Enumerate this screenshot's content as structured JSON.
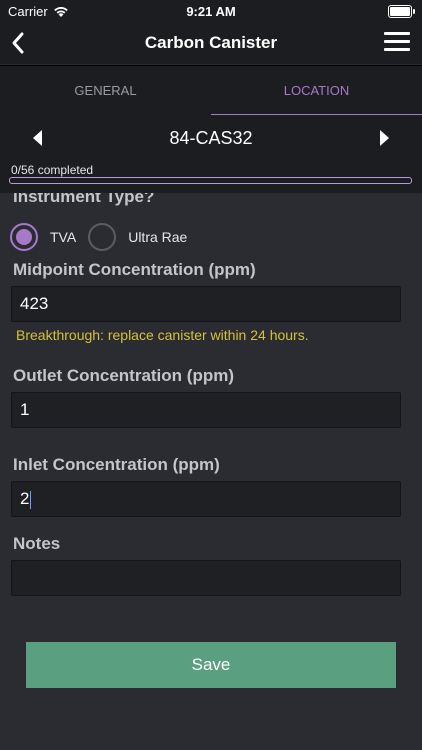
{
  "status_bar": {
    "carrier": "Carrier",
    "time": "9:21 AM",
    "battery_level": 1.0
  },
  "header": {
    "title": "Carbon Canister"
  },
  "tabs": [
    {
      "label": "GENERAL",
      "active": false
    },
    {
      "label": "LOCATION",
      "active": true
    }
  ],
  "selector": {
    "current": "84-CAS32"
  },
  "progress": {
    "text": "0/56 completed",
    "fraction": 0.0
  },
  "form": {
    "instrument_type": {
      "label": "Instrument Type?",
      "options": [
        {
          "label": "TVA",
          "selected": true
        },
        {
          "label": "Ultra Rae",
          "selected": false
        }
      ]
    },
    "midpoint": {
      "label": "Midpoint Concentration (ppm)",
      "value": "423"
    },
    "warning": "Breakthrough: replace canister within 24 hours.",
    "outlet": {
      "label": "Outlet Concentration (ppm)",
      "value": "1"
    },
    "inlet": {
      "label": "Inlet Concentration (ppm)",
      "value": "2"
    },
    "notes": {
      "label": "Notes",
      "value": ""
    }
  },
  "save_label": "Save",
  "colors": {
    "accent": "#a679c9",
    "header_bg": "#1c1d20",
    "body_bg": "#2a2c31",
    "warning": "#d4c23a",
    "save_button": "#5a9f80"
  }
}
